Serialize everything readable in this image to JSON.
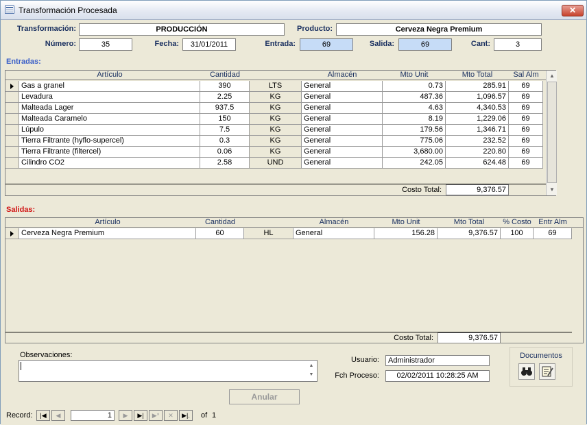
{
  "window": {
    "title": "Transformación Procesada",
    "close": "✕"
  },
  "header": {
    "transformacion_label": "Transformación:",
    "transformacion_value": "PRODUCCIÓN",
    "producto_label": "Producto:",
    "producto_value": "Cerveza Negra Premium",
    "numero_label": "Número:",
    "numero_value": "35",
    "fecha_label": "Fecha:",
    "fecha_value": "31/01/2011",
    "entrada_label": "Entrada:",
    "entrada_value": "69",
    "salida_label": "Salida:",
    "salida_value": "69",
    "cant_label": "Cant:",
    "cant_value": "3"
  },
  "entradas": {
    "title": "Entradas:",
    "title_color": "#3a5fc8",
    "columns": [
      "Artículo",
      "Cantidad",
      "",
      "Almacén",
      "Mto Unit",
      "Mto Total",
      "Sal Alm"
    ],
    "rows": [
      [
        "Gas a granel",
        "390",
        "LTS",
        "General",
        "0.73",
        "285.91",
        "69"
      ],
      [
        "Levadura",
        "2.25",
        "KG",
        "General",
        "487.36",
        "1,096.57",
        "69"
      ],
      [
        "Malteada Lager",
        "937.5",
        "KG",
        "General",
        "4.63",
        "4,340.53",
        "69"
      ],
      [
        "Malteada Caramelo",
        "150",
        "KG",
        "General",
        "8.19",
        "1,229.06",
        "69"
      ],
      [
        "Lúpulo",
        "7.5",
        "KG",
        "General",
        "179.56",
        "1,346.71",
        "69"
      ],
      [
        "Tierra Filtrante (hyflo-supercel)",
        "0.3",
        "KG",
        "General",
        "775.06",
        "232.52",
        "69"
      ],
      [
        "Tierra Filtrante (filtercel)",
        "0.06",
        "KG",
        "General",
        "3,680.00",
        "220.80",
        "69"
      ],
      [
        "Cilindro CO2",
        "2.58",
        "UND",
        "General",
        "242.05",
        "624.48",
        "69"
      ]
    ],
    "total_label": "Costo Total:",
    "total_value": "9,376.57"
  },
  "salidas": {
    "title": "Salidas:",
    "title_color": "#d01010",
    "columns": [
      "Artículo",
      "Cantidad",
      "",
      "Almacén",
      "Mto Unit",
      "Mto Total",
      "% Costo",
      "Entr Alm"
    ],
    "rows": [
      [
        "Cerveza Negra Premium",
        "60",
        "HL",
        "General",
        "156.28",
        "9,376.57",
        "100",
        "69"
      ]
    ],
    "total_label": "Costo Total:",
    "total_value": "9,376.57"
  },
  "footer": {
    "observaciones_label": "Observaciones:",
    "usuario_label": "Usuario:",
    "usuario_value": "Administrador",
    "fch_label": "Fch Proceso:",
    "fch_value": "02/02/2011 10:28:25 AM",
    "documentos_label": "Documentos",
    "anular_label": "Anular",
    "record_label": "Record:",
    "record_value": "1",
    "record_of": "of",
    "record_total": "1"
  }
}
